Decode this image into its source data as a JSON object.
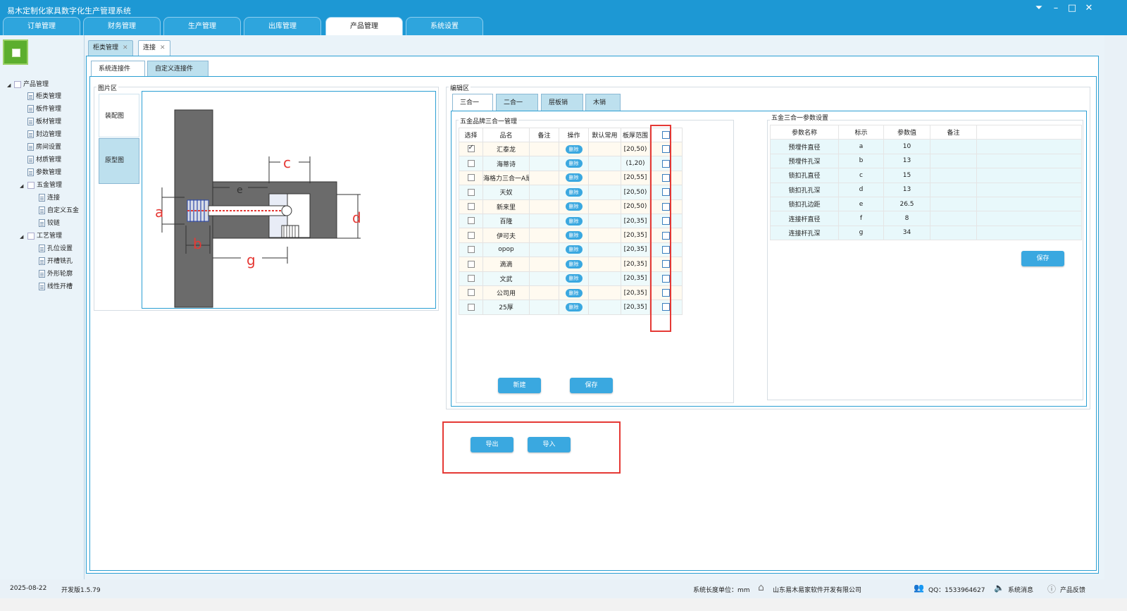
{
  "window": {
    "title": "易木定制化家具数字化生产管理系统"
  },
  "menu": {
    "tabs": [
      {
        "label": "订单管理"
      },
      {
        "label": "财务管理"
      },
      {
        "label": "生产管理"
      },
      {
        "label": "出库管理"
      },
      {
        "label": "产品管理"
      },
      {
        "label": "系统设置"
      }
    ],
    "active": "产品管理"
  },
  "tree": {
    "root": "产品管理",
    "items": [
      {
        "label": "柜类管理"
      },
      {
        "label": "板件管理"
      },
      {
        "label": "板材管理"
      },
      {
        "label": "封边管理"
      },
      {
        "label": "房间设置"
      },
      {
        "label": "材质管理"
      },
      {
        "label": "参数管理"
      }
    ],
    "hardware": {
      "label": "五金管理",
      "children": [
        {
          "label": "连接"
        },
        {
          "label": "自定义五金"
        },
        {
          "label": "铰链"
        }
      ]
    },
    "craft": {
      "label": "工艺管理",
      "children": [
        {
          "label": "孔位设置"
        },
        {
          "label": "开槽铣孔"
        },
        {
          "label": "外形轮廓"
        },
        {
          "label": "线性开槽"
        }
      ]
    }
  },
  "doctabs": [
    {
      "label": "柜类管理"
    },
    {
      "label": "连接"
    }
  ],
  "subtabs": [
    {
      "label": "系统连接件"
    },
    {
      "label": "自定义连接件"
    }
  ],
  "image_area": {
    "legend": "图片区",
    "tabs": [
      {
        "label": "装配图"
      },
      {
        "label": "原型图"
      }
    ],
    "labels": {
      "a": "a",
      "b": "b",
      "c": "c",
      "d": "d",
      "e": "e",
      "g": "g"
    }
  },
  "editor": {
    "legend": "编辑区",
    "tabs": [
      {
        "label": "三合一"
      },
      {
        "label": "二合一"
      },
      {
        "label": "层板销"
      },
      {
        "label": "木销"
      }
    ],
    "brand_legend": "五金品牌三合一管理",
    "brand_columns": [
      "选择",
      "品名",
      "备注",
      "操作",
      "默认常用",
      "板厚范围"
    ],
    "delete_label": "删除",
    "brands": [
      {
        "name": "汇泰龙",
        "note": "",
        "range": "[20,50)",
        "selected": true
      },
      {
        "name": "海蒂诗",
        "note": "",
        "range": "(1,20)",
        "selected": false
      },
      {
        "name": "海格力三合一A是",
        "note": "",
        "range": "[20,55]",
        "selected": false
      },
      {
        "name": "天奴",
        "note": "",
        "range": "[20,50)",
        "selected": false
      },
      {
        "name": "新来里",
        "note": "",
        "range": "[20,50)",
        "selected": false
      },
      {
        "name": "百隆",
        "note": "",
        "range": "[20,35]",
        "selected": false
      },
      {
        "name": "伊可夫",
        "note": "",
        "range": "[20,35]",
        "selected": false
      },
      {
        "name": "opop",
        "note": "",
        "range": "[20,35]",
        "selected": false
      },
      {
        "name": "滴滴",
        "note": "",
        "range": "[20,35]",
        "selected": false
      },
      {
        "name": "文武",
        "note": "",
        "range": "[20,35]",
        "selected": false
      },
      {
        "name": "公司用",
        "note": "",
        "range": "[20,35]",
        "selected": false
      },
      {
        "name": "25厚",
        "note": "",
        "range": "[20,35]",
        "selected": false
      }
    ],
    "new_button": "新建",
    "save_button": "保存",
    "param_legend": "五金三合一参数设置",
    "param_columns": [
      "参数名称",
      "标示",
      "参数值",
      "备注"
    ],
    "params": [
      {
        "name": "预埋件直径",
        "mark": "a",
        "value": "10",
        "note": ""
      },
      {
        "name": "预埋件孔深",
        "mark": "b",
        "value": "13",
        "note": ""
      },
      {
        "name": "锁扣孔直径",
        "mark": "c",
        "value": "15",
        "note": ""
      },
      {
        "name": "锁扣孔孔深",
        "mark": "d",
        "value": "13",
        "note": ""
      },
      {
        "name": "锁扣孔边距",
        "mark": "e",
        "value": "26.5",
        "note": ""
      },
      {
        "name": "连接杆直径",
        "mark": "f",
        "value": "8",
        "note": ""
      },
      {
        "name": "连接杆孔深",
        "mark": "g",
        "value": "34",
        "note": ""
      }
    ],
    "param_save_button": "保存"
  },
  "actions": {
    "export": "导出",
    "import": "导入"
  },
  "status": {
    "date": "2025-08-22",
    "version": "开发版1.5.79",
    "unit": "系统长度单位：mm",
    "company": "山东易木易家软件开发有限公司",
    "qq": "QQ：1533964627",
    "messages": "系统消息",
    "feedback": "产品反馈"
  },
  "colors": {
    "accent": "#1d98d4",
    "highlight": "#e53935",
    "button": "#3aa8e0"
  }
}
